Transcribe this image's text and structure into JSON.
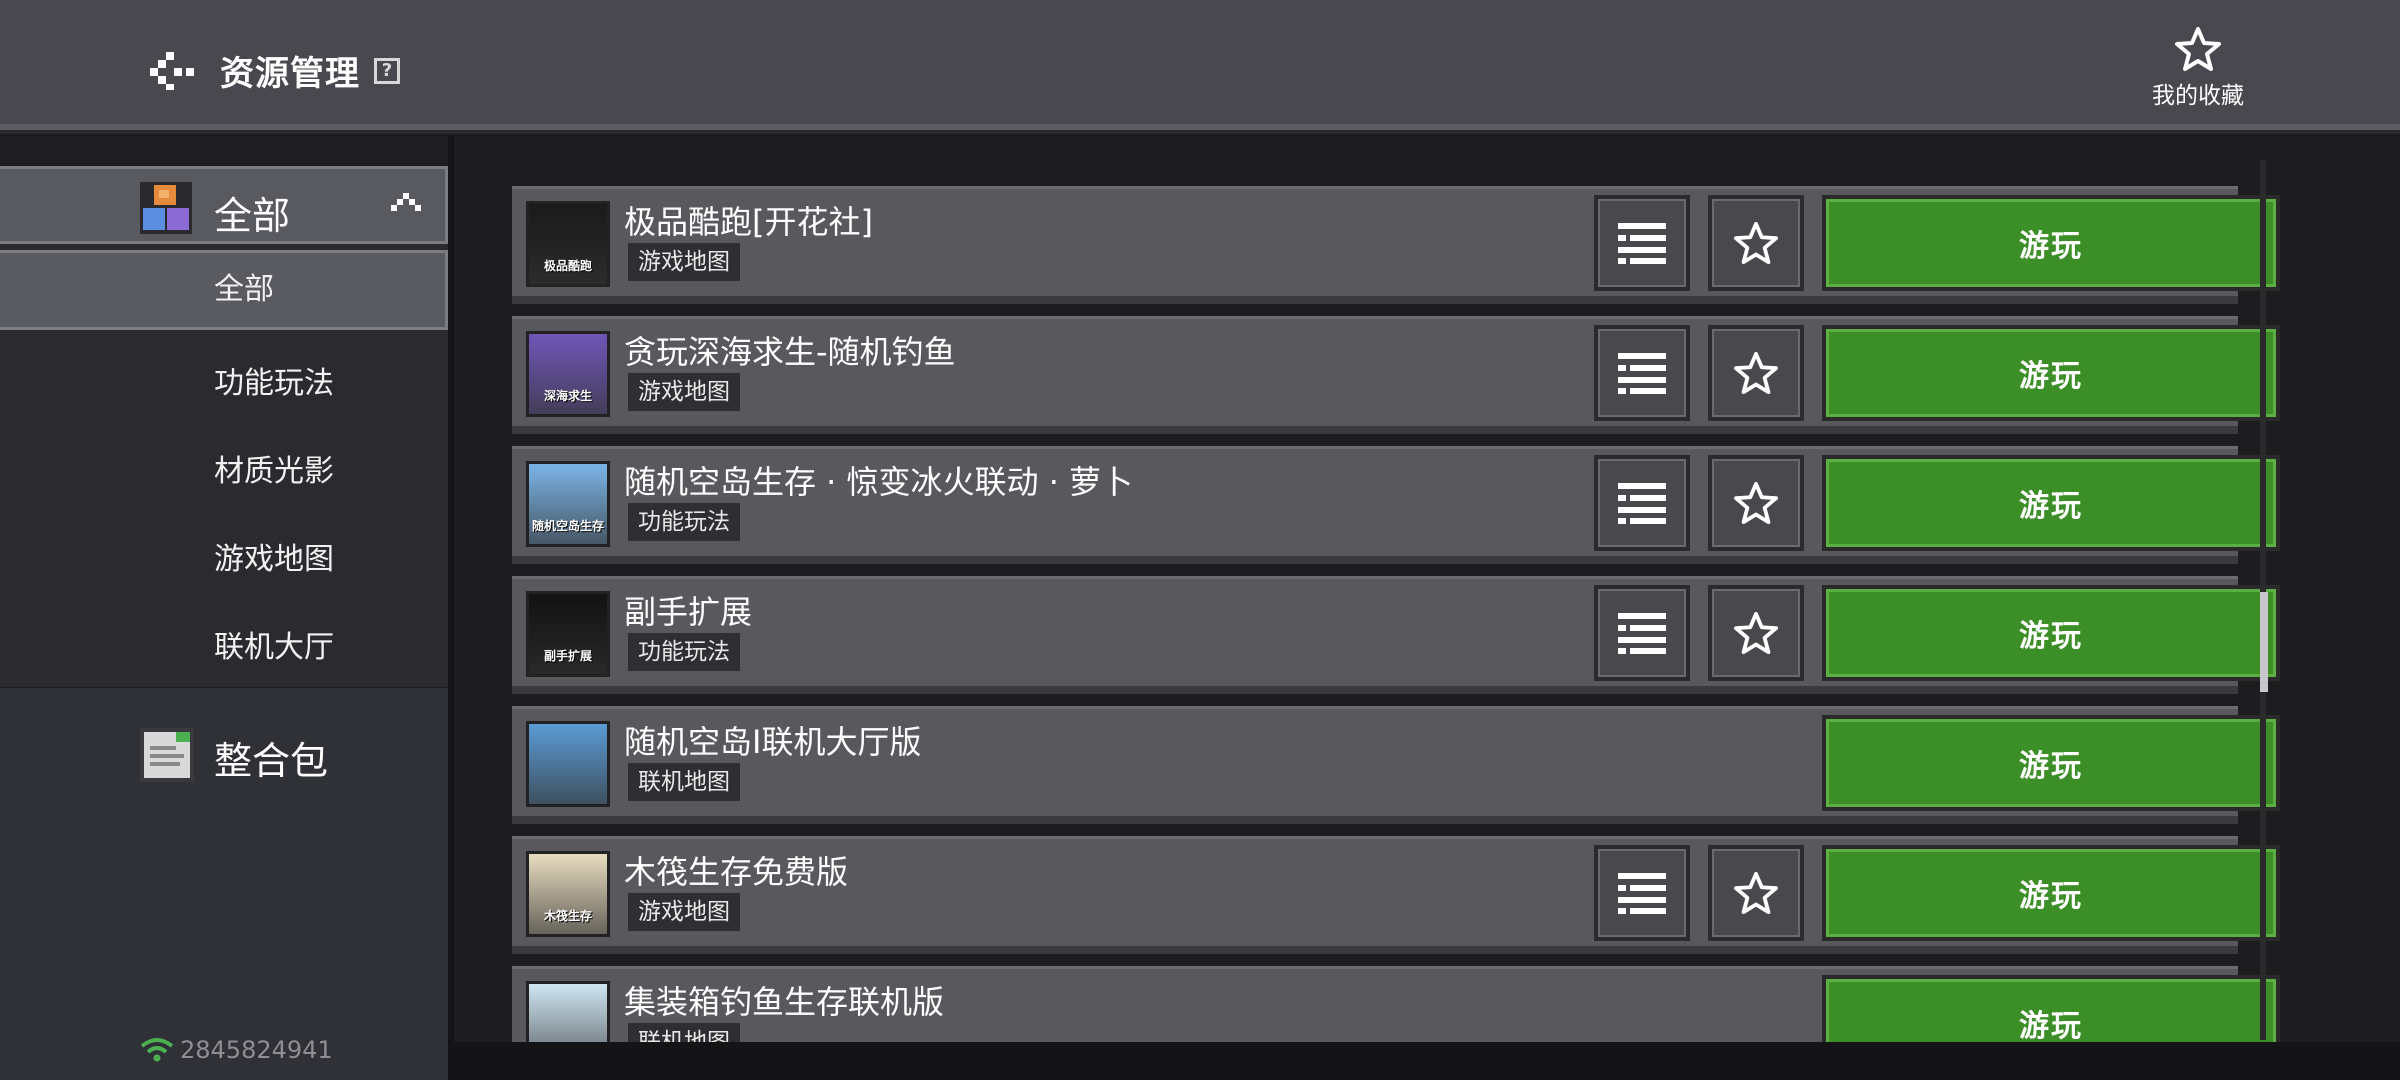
{
  "header": {
    "title": "资源管理",
    "help_glyph": "?",
    "favorites_label": "我的收藏"
  },
  "sidebar": {
    "category": "全部",
    "sub_items": [
      {
        "label": "全部",
        "active": true
      },
      {
        "label": "功能玩法",
        "active": false
      },
      {
        "label": "材质光影",
        "active": false
      },
      {
        "label": "游戏地图",
        "active": false
      },
      {
        "label": "联机大厅",
        "active": false
      }
    ],
    "pack_label": "整合包",
    "network_id": "2845824941"
  },
  "resources": [
    {
      "title": "极品酷跑[开花社]",
      "tag": "游戏地图",
      "play": "游玩",
      "has_actions": true,
      "thumb_text": "极品酷跑",
      "thumb_color": "#1a1a1a"
    },
    {
      "title": "贪玩深海求生-随机钓鱼",
      "tag": "游戏地图",
      "play": "游玩",
      "has_actions": true,
      "thumb_text": "深海求生",
      "thumb_color": "#6f56b8"
    },
    {
      "title": "随机空岛生存 · 惊变冰火联动 · 萝卜",
      "tag": "功能玩法",
      "play": "游玩",
      "has_actions": true,
      "thumb_text": "随机空岛生存",
      "thumb_color": "#7bb3e6"
    },
    {
      "title": "副手扩展",
      "tag": "功能玩法",
      "play": "游玩",
      "has_actions": true,
      "thumb_text": "副手扩展",
      "thumb_color": "#121212"
    },
    {
      "title": "随机空岛I联机大厅版",
      "tag": "联机地图",
      "play": "游玩",
      "has_actions": false,
      "thumb_text": "",
      "thumb_color": "#5b9bd5"
    },
    {
      "title": "木筏生存免费版",
      "tag": "游戏地图",
      "play": "游玩",
      "has_actions": true,
      "thumb_text": "木筏生存",
      "thumb_color": "#e8dcc0"
    },
    {
      "title": "集装箱钓鱼生存联机版",
      "tag": "联机地图",
      "play": "游玩",
      "has_actions": false,
      "thumb_text": "",
      "thumb_color": "#cfe6f3"
    }
  ],
  "colors": {
    "play_green": "#3c8e27",
    "accent_wifi": "#4caf50"
  }
}
